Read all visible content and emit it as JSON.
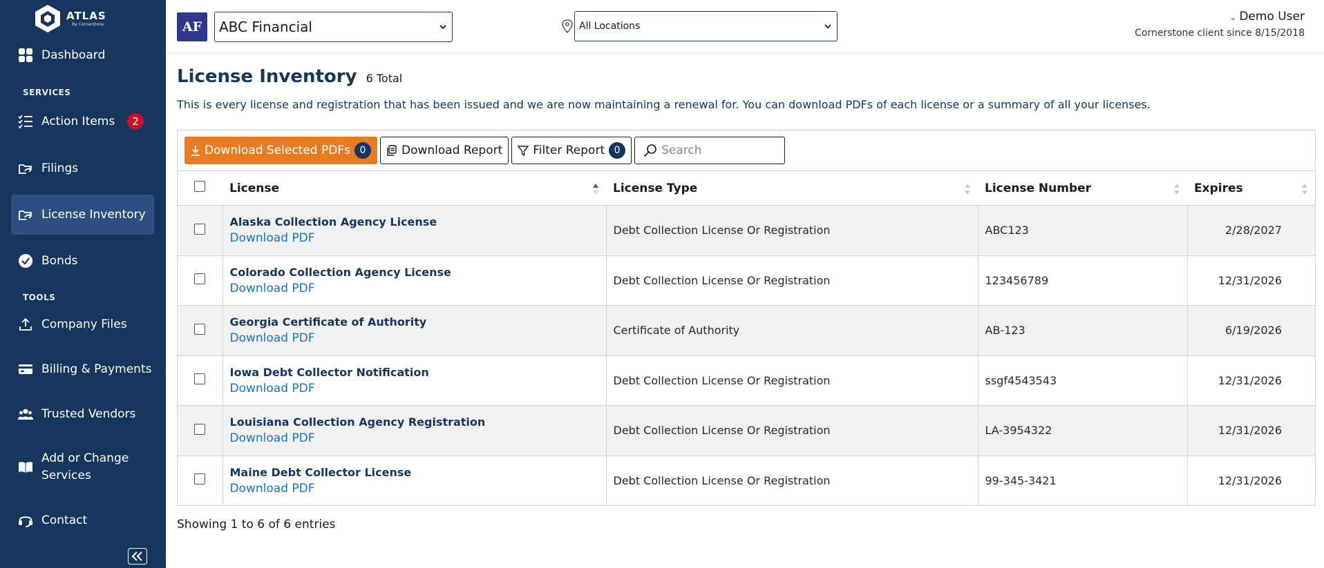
{
  "brand": {
    "title": "ATLAS",
    "subtitle": "By Cornerstone"
  },
  "sidebar": {
    "items": [
      {
        "key": "dashboard",
        "label": "Dashboard",
        "icon": "grid-icon"
      },
      {
        "key": "action-items",
        "label": "Action Items",
        "icon": "list-icon",
        "badge": "2"
      },
      {
        "key": "filings",
        "label": "Filings",
        "icon": "folder-arrow-icon"
      },
      {
        "key": "license-inventory",
        "label": "License Inventory",
        "icon": "folder-arrow-icon",
        "active": true
      },
      {
        "key": "bonds",
        "label": "Bonds",
        "icon": "verified-badge-icon"
      },
      {
        "key": "company-files",
        "label": "Company Files",
        "icon": "upload-icon"
      },
      {
        "key": "billing",
        "label": "Billing & Payments",
        "icon": "credit-card-icon"
      },
      {
        "key": "trusted-vendors",
        "label": "Trusted Vendors",
        "icon": "users-icon"
      },
      {
        "key": "services",
        "label": "Add or Change Services",
        "icon": "book-icon"
      },
      {
        "key": "contact",
        "label": "Contact",
        "icon": "headset-icon"
      }
    ],
    "sections": {
      "services": "SERVICES",
      "tools": "TOOLS"
    }
  },
  "header": {
    "avatar_initials": "AF",
    "company": "ABC Financial",
    "location": "All Locations",
    "user_name": "Demo User",
    "user_since": "Cornerstone client since 8/15/2018"
  },
  "main": {
    "title": "License Inventory",
    "count": "6 Total",
    "description": "This is every license and registration that has been issued and we are now maintaining a renewal for. You can download PDFs of each license or a summary of all your licenses.",
    "toolbar": {
      "download_selected_label": "Download Selected PDFs",
      "download_selected_count": "0",
      "download_report_label": "Download Report",
      "filter_report_label": "Filter Report",
      "filter_count": "0",
      "search_placeholder": "Search"
    },
    "columns": [
      "License",
      "License Type",
      "License Number",
      "Expires"
    ],
    "rows": [
      {
        "name": "Alaska Collection Agency License",
        "link": "Download PDF",
        "type": "Debt Collection License Or Registration",
        "number": "ABC123",
        "expires": "2/28/2027"
      },
      {
        "name": "Colorado Collection Agency License",
        "link": "Download PDF",
        "type": "Debt Collection License Or Registration",
        "number": "123456789",
        "expires": "12/31/2026"
      },
      {
        "name": "Georgia Certificate of Authority",
        "link": "Download PDF",
        "type": "Certificate of Authority",
        "number": "AB-123",
        "expires": "6/19/2026"
      },
      {
        "name": "Iowa Debt Collector Notification",
        "link": "Download PDF",
        "type": "Debt Collection License Or Registration",
        "number": "ssgf4543543",
        "expires": "12/31/2026"
      },
      {
        "name": "Louisiana Collection Agency Registration",
        "link": "Download PDF",
        "type": "Debt Collection License Or Registration",
        "number": "LA-3954322",
        "expires": "12/31/2026"
      },
      {
        "name": "Maine Debt Collector License",
        "link": "Download PDF",
        "type": "Debt Collection License Or Registration",
        "number": "99-345-3421",
        "expires": "12/31/2026"
      }
    ],
    "footer": "Showing 1 to 6 of 6 entries"
  },
  "colors": {
    "sidebar": "#17365d",
    "accent": "#e77c22",
    "link": "#1a73c8",
    "badge": "#c8102e"
  }
}
